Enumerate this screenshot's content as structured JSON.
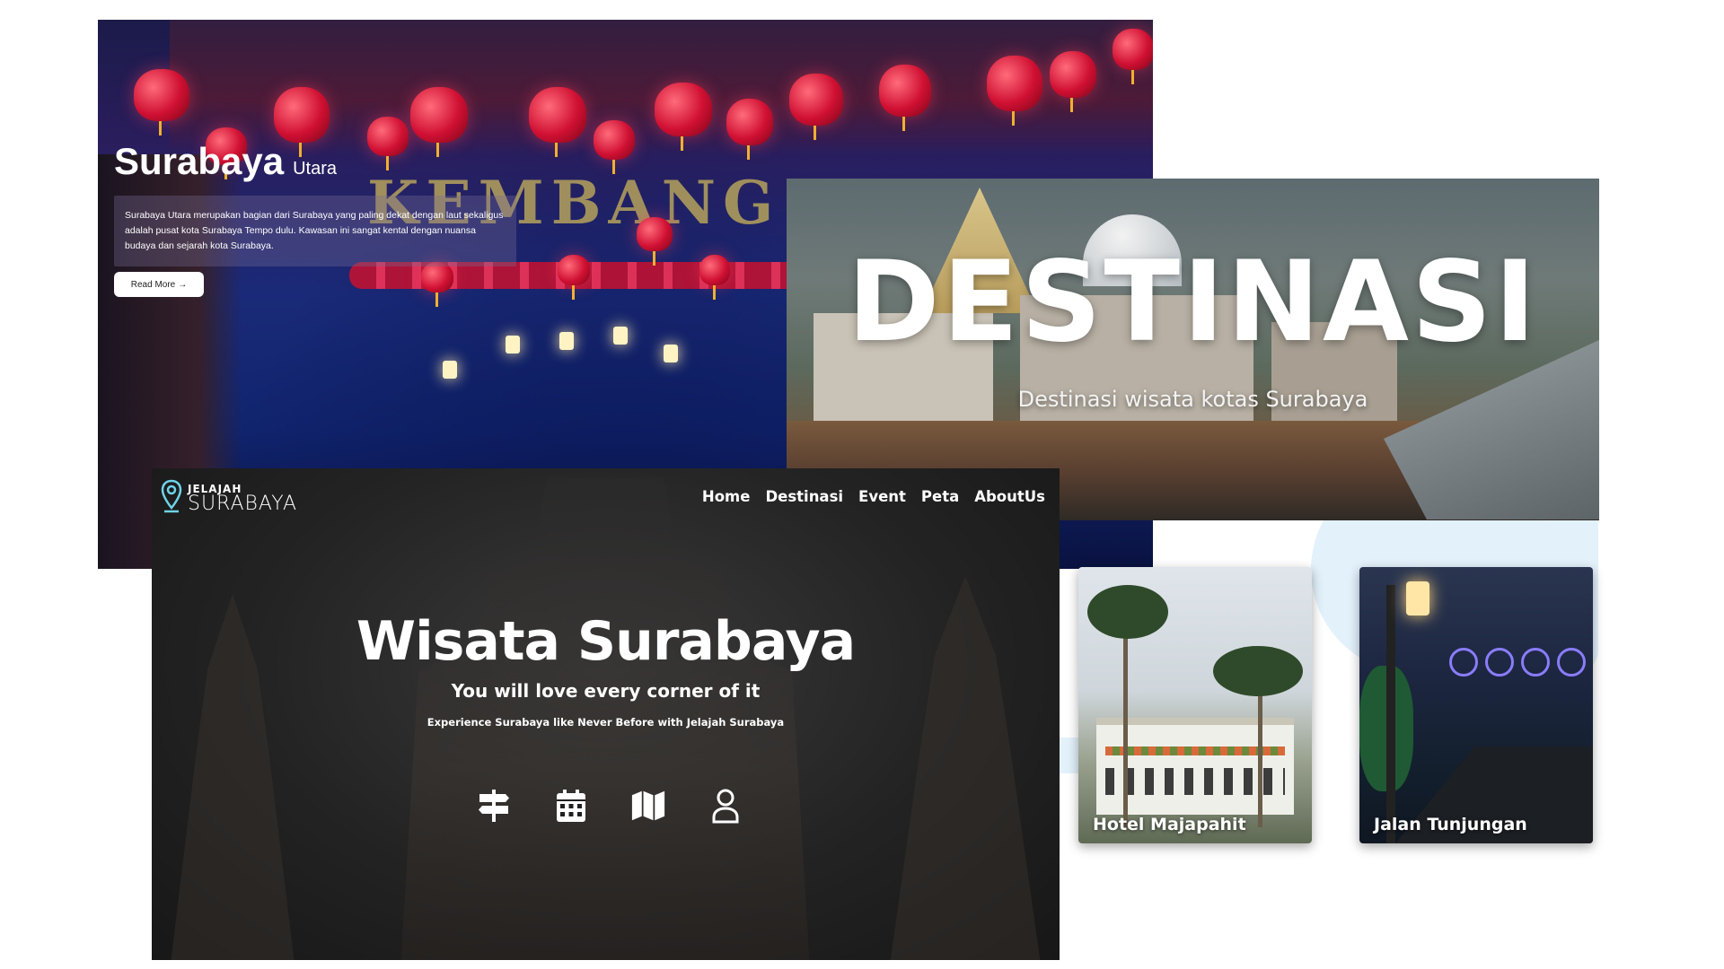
{
  "utara_panel": {
    "title": "Surabaya",
    "subtitle": "Utara",
    "description": "Surabaya Utara merupakan bagian dari Surabaya yang paling dekat dengan laut sekaligus adalah pusat kota Surabaya Tempo dulu. Kawasan ini sangat kental dengan nuansa budaya dan sejarah kota Surabaya.",
    "read_more": "Read More",
    "read_more_arrow": "→"
  },
  "destinasi_panel": {
    "headline": "DESTINASI",
    "subtitle": "Destinasi wisata kotas Surabaya"
  },
  "wisata_panel": {
    "logo_top": "JELAJAH",
    "logo_bottom": "SURABAYA",
    "nav": [
      "Home",
      "Destinasi",
      "Event",
      "Peta",
      "AboutUs"
    ],
    "hero_title": "Wisata Surabaya",
    "hero_subtitle": "You will love every corner of it",
    "hero_tagline": "Experience Surabaya like Never Before with Jelajah Surabaya",
    "icons": [
      "signpost-icon",
      "calendar-icon",
      "map-icon",
      "user-icon"
    ]
  },
  "cards": [
    {
      "label": "Hotel Majapahit"
    },
    {
      "label": "Jalan Tunjungan"
    }
  ],
  "colors": {
    "lantern_red": "#d01033",
    "logo_accent": "#6fd3e8",
    "bubble": "#e3f1fb"
  }
}
